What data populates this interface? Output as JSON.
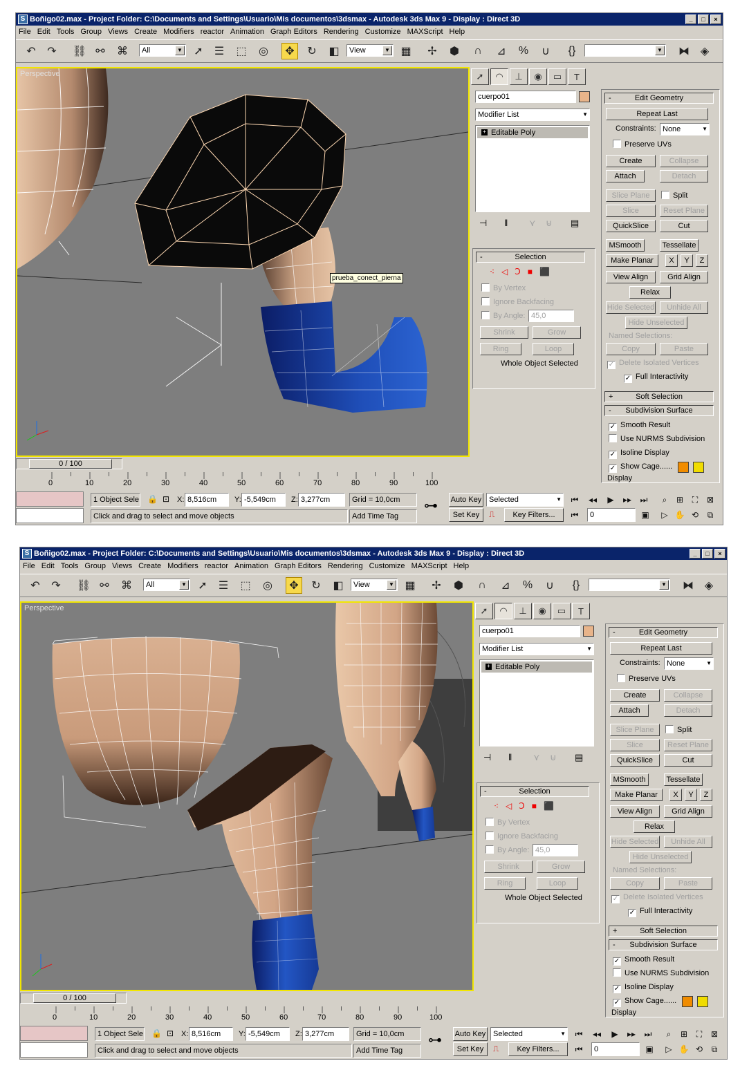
{
  "title": "Boñigo02.max    - Project Folder: C:\\Documents and Settings\\Usuario\\Mis documentos\\3dsmax    - Autodesk 3ds Max 9    - Display : Direct 3D",
  "menu": [
    "File",
    "Edit",
    "Tools",
    "Group",
    "Views",
    "Create",
    "Modifiers",
    "reactor",
    "Animation",
    "Graph Editors",
    "Rendering",
    "Customize",
    "MAXScript",
    "Help"
  ],
  "toolbar": {
    "selection_filter": "All",
    "ref_coord": "View"
  },
  "viewport": {
    "label": "Perspective",
    "tooltip": "prueba_conect_pierna"
  },
  "panel": {
    "object_name": "cuerpo01",
    "object_color": "#e8b48a",
    "modifier_list": "Modifier List",
    "stack_item": "Editable Poly",
    "selection": {
      "title": "Selection",
      "by_vertex": "By Vertex",
      "ignore_backfacing": "Ignore Backfacing",
      "by_angle": "By Angle:",
      "angle_value": "45,0",
      "shrink": "Shrink",
      "grow": "Grow",
      "ring": "Ring",
      "loop": "Loop",
      "status": "Whole Object Selected"
    },
    "edit_geometry": {
      "title": "Edit Geometry",
      "repeat_last": "Repeat Last",
      "constraints_label": "Constraints:",
      "constraints_value": "None",
      "preserve_uvs": "Preserve UVs",
      "create": "Create",
      "collapse": "Collapse",
      "attach": "Attach",
      "detach": "Detach",
      "slice_plane": "Slice Plane",
      "split": "Split",
      "slice": "Slice",
      "reset_plane": "Reset Plane",
      "quickslice": "QuickSlice",
      "cut": "Cut",
      "msmooth": "MSmooth",
      "tessellate": "Tessellate",
      "make_planar": "Make Planar",
      "x": "X",
      "y": "Y",
      "z": "Z",
      "view_align": "View Align",
      "grid_align": "Grid Align",
      "relax": "Relax",
      "hide_selected": "Hide Selected",
      "unhide_all": "Unhide All",
      "hide_unselected": "Hide Unselected",
      "named_selections": "Named Selections:",
      "copy": "Copy",
      "paste": "Paste",
      "delete_isolated": "Delete Isolated Vertices",
      "full_interactivity": "Full Interactivity"
    },
    "soft_selection": "Soft Selection",
    "subdivision": {
      "title": "Subdivision Surface",
      "smooth_result": "Smooth Result",
      "use_nurms": "Use NURMS Subdivision",
      "isoline": "Isoline Display",
      "show_cage": "Show Cage......",
      "cage_color1": "#f08c00",
      "cage_color2": "#f0dc00"
    },
    "display": "Display"
  },
  "timeline": {
    "slider": "0 / 100",
    "ticks": [
      "0",
      "10",
      "20",
      "30",
      "40",
      "50",
      "60",
      "70",
      "80",
      "90",
      "100"
    ]
  },
  "status": {
    "selected_count": "1 Object Sele",
    "x_label": "X:",
    "x": "8,516cm",
    "y_label": "Y:",
    "y": "-5,549cm",
    "z_label": "Z:",
    "z": "3,277cm",
    "grid": "Grid = 10,0cm",
    "prompt": "Click and drag to select and move objects",
    "add_time_tag": "Add Time Tag",
    "auto_key": "Auto Key",
    "set_key": "Set Key",
    "key_mode": "Selected",
    "key_filters": "Key Filters...",
    "frame": "0"
  }
}
